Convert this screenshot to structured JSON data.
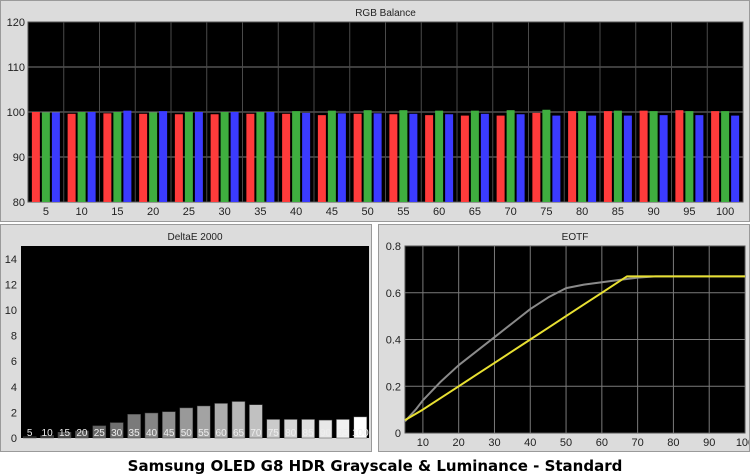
{
  "caption": "Samsung OLED G8 HDR Grayscale & Luminance - Standard",
  "chart_data": [
    {
      "type": "bar",
      "title": "RGB Balance",
      "categories": [
        "5",
        "10",
        "15",
        "20",
        "25",
        "30",
        "35",
        "40",
        "45",
        "50",
        "55",
        "60",
        "65",
        "70",
        "75",
        "80",
        "85",
        "90",
        "95",
        "100"
      ],
      "ylim": [
        80,
        120
      ],
      "yticks": [
        80,
        90,
        100,
        110,
        120
      ],
      "grid": true,
      "series": [
        {
          "color": "#ff3b3b",
          "values": [
            100,
            99.6,
            99.7,
            99.6,
            99.5,
            99.5,
            99.6,
            99.6,
            99.3,
            99.6,
            99.5,
            99.3,
            99.2,
            99.2,
            99.8,
            100.2,
            100.2,
            100.3,
            100.4,
            100.2
          ]
        },
        {
          "color": "#3fae3f",
          "values": [
            99.9,
            100,
            100,
            99.9,
            100,
            100,
            100,
            100.2,
            100.3,
            100.4,
            100.4,
            100.3,
            100.3,
            100.4,
            100.5,
            100.2,
            100.3,
            100.2,
            100.2,
            100.2
          ]
        },
        {
          "color": "#3b3bff",
          "values": [
            99.9,
            100,
            100.3,
            100.2,
            100,
            100,
            100,
            99.8,
            99.7,
            99.7,
            99.6,
            99.5,
            99.6,
            99.5,
            99.2,
            99.2,
            99.2,
            99.3,
            99.3,
            99.2
          ]
        }
      ]
    },
    {
      "type": "bar",
      "title": "DeltaE 2000",
      "categories": [
        "5",
        "10",
        "15",
        "20",
        "25",
        "30",
        "35",
        "40",
        "45",
        "50",
        "55",
        "60",
        "65",
        "70",
        "75",
        "80",
        "85",
        "90",
        "95",
        "100"
      ],
      "ylim": [
        0,
        15
      ],
      "yticks": [
        0,
        2,
        4,
        6,
        8,
        10,
        12,
        14
      ],
      "values": [
        0.1,
        0.2,
        0.45,
        0.55,
        0.95,
        1.2,
        1.85,
        1.95,
        2.05,
        2.35,
        2.5,
        2.7,
        2.85,
        2.6,
        1.45,
        1.45,
        1.45,
        1.4,
        1.45,
        1.65
      ],
      "colors": [
        "#2a2a2a",
        "#3a3a3a",
        "#4a4a4a",
        "#5a5a5a",
        "#666666",
        "#707070",
        "#7a7a7a",
        "#858585",
        "#8f8f8f",
        "#999999",
        "#a3a3a3",
        "#adadad",
        "#b7b7b7",
        "#c1c1c1",
        "#cbcbcb",
        "#d5d5d5",
        "#dfdfdf",
        "#e8e8e8",
        "#f2f2f2",
        "#ffffff"
      ]
    },
    {
      "type": "line",
      "title": "EOTF",
      "xlim": [
        5,
        100
      ],
      "ylim": [
        0,
        0.8
      ],
      "xticks": [
        10,
        20,
        30,
        40,
        50,
        60,
        70,
        80,
        90,
        100
      ],
      "yticks": [
        0,
        0.2,
        0.4,
        0.6,
        0.8
      ],
      "grid": true,
      "series": [
        {
          "color": "#8a8a8a",
          "x": [
            5,
            8,
            10,
            15,
            20,
            25,
            30,
            35,
            40,
            45,
            50,
            55,
            60,
            65,
            70,
            75,
            80,
            90,
            100
          ],
          "y": [
            0.05,
            0.1,
            0.14,
            0.22,
            0.29,
            0.35,
            0.41,
            0.47,
            0.53,
            0.58,
            0.62,
            0.635,
            0.645,
            0.655,
            0.665,
            0.67,
            0.67,
            0.67,
            0.67
          ]
        },
        {
          "color": "#e8e032",
          "x": [
            5,
            10,
            15,
            20,
            25,
            30,
            35,
            40,
            45,
            50,
            55,
            60,
            65,
            67,
            70,
            80,
            90,
            100
          ],
          "y": [
            0.055,
            0.1,
            0.15,
            0.2,
            0.25,
            0.3,
            0.35,
            0.4,
            0.45,
            0.5,
            0.55,
            0.6,
            0.65,
            0.67,
            0.67,
            0.67,
            0.67,
            0.67
          ]
        }
      ]
    }
  ]
}
